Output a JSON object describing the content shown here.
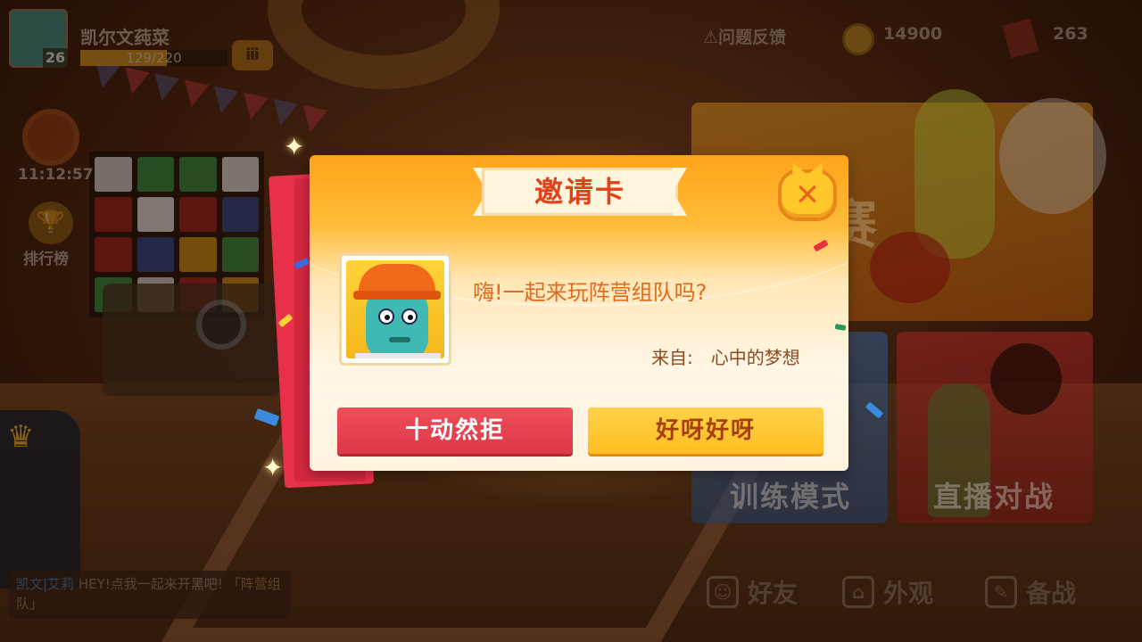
{
  "player": {
    "name": "凯尔文莼菜",
    "level": "26",
    "xp_text": "129/220",
    "xp_progress": 0.586
  },
  "hud": {
    "feedback_label": "问题反馈",
    "coins": "14900",
    "cards": "263"
  },
  "side": {
    "timer": "11:12:57",
    "leaderboard_label": "排行榜"
  },
  "background_panels": {
    "match_char": "赛",
    "training": "训练模式",
    "live_battle": "直播对战"
  },
  "chat": {
    "sender": "凯文|艾莉",
    "text": "HEY!点我一起来开黑吧!",
    "link": "「阵营组队」"
  },
  "bottom_nav": {
    "friends": "好友",
    "appearance": "外观",
    "prepare": "备战"
  },
  "dialog": {
    "title": "邀请卡",
    "message": "嗨!一起来玩阵营组队吗?",
    "from_label": "来自:",
    "from_name": "心中的梦想",
    "refuse_label": "十动然拒",
    "accept_label": "好呀好呀"
  },
  "icons": {
    "close": "close-icon",
    "coin": "coin-icon",
    "warning": "warning-icon",
    "trophy": "trophy-icon",
    "tv": "tv-icon",
    "card": "red-card-icon"
  },
  "colors": {
    "refuse": "#e8404e",
    "accept": "#ffc52e",
    "title": "#e0421a",
    "message": "#e06a1e"
  }
}
